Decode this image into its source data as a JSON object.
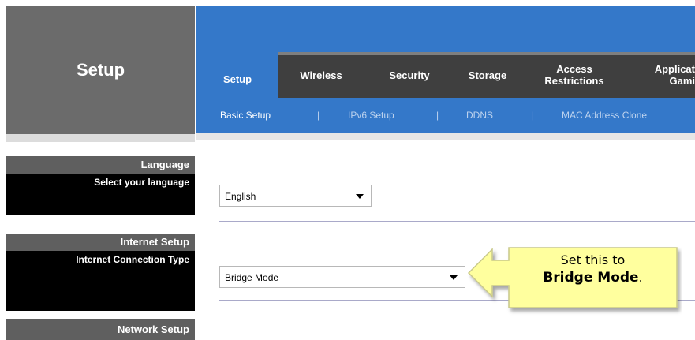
{
  "sidebar": {
    "title": "Setup",
    "sections": [
      {
        "heading": "Language",
        "label": "Select your language"
      },
      {
        "heading": "Internet Setup",
        "label": "Internet Connection Type"
      },
      {
        "heading": "Network Setup",
        "label": ""
      }
    ]
  },
  "nav": {
    "tabs": [
      {
        "label": "Setup",
        "active": true
      },
      {
        "label": "Wireless"
      },
      {
        "label": "Security"
      },
      {
        "label": "Storage"
      },
      {
        "label": "Access Restrictions"
      },
      {
        "label": "Applicat... Gami..."
      }
    ],
    "tab_access_line1": "Access",
    "tab_access_line2": "Restrictions",
    "tab_app_line1": "Applicat",
    "tab_app_line2": "Gami"
  },
  "subnav": {
    "items": [
      "Basic Setup",
      "IPv6 Setup",
      "DDNS",
      "MAC Address Clone"
    ],
    "separator": "|"
  },
  "language_select": {
    "value": "English"
  },
  "connection_select": {
    "value": "Bridge Mode"
  },
  "callout": {
    "line1": "Set this to",
    "line2_bold": "Bridge Mode",
    "line2_end": "."
  },
  "colors": {
    "accent_blue": "#3478c9",
    "nav_dark": "#3f3f3f",
    "sidebar_gray": "#6b6b6b",
    "callout_yellow": "#ffff9e"
  }
}
